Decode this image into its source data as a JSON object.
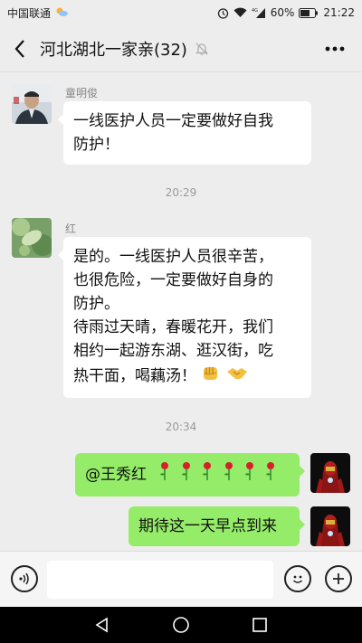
{
  "status_bar": {
    "carrier": "中国联通",
    "battery": "60%",
    "time": "21:22"
  },
  "header": {
    "title": "河北湖北一家亲(32)",
    "icons": [
      "back-arrow-icon",
      "mute-bell-icon",
      "more-icon"
    ]
  },
  "messages": [
    {
      "sender": "童明俊",
      "side": "left",
      "lines": [
        "一线医护人员一定要做好自我",
        "防护！"
      ]
    },
    {
      "time": "20:29"
    },
    {
      "sender": "红",
      "side": "left",
      "lines": [
        "是的。一线医护人员很辛苦，",
        "也很危险，一定要做好自身的",
        "防护。",
        "待雨过天晴，春暖花开，我们",
        "相约一起游东湖、逛汉街，吃",
        "热干面，喝藕汤！"
      ],
      "emojis": [
        "fist-icon",
        "handshake-icon"
      ]
    },
    {
      "time": "20:34"
    },
    {
      "side": "right",
      "text": "@王秀红",
      "emojis": [
        "rose-icon",
        "rose-icon",
        "rose-icon",
        "rose-icon",
        "rose-icon",
        "rose-icon"
      ]
    },
    {
      "side": "right",
      "text": "期待这一天早点到来"
    }
  ],
  "input_bar": {
    "value": "",
    "placeholder": ""
  },
  "colors": {
    "background": "#ededed",
    "bubble_self": "#95ec69",
    "bubble_other": "#ffffff"
  }
}
